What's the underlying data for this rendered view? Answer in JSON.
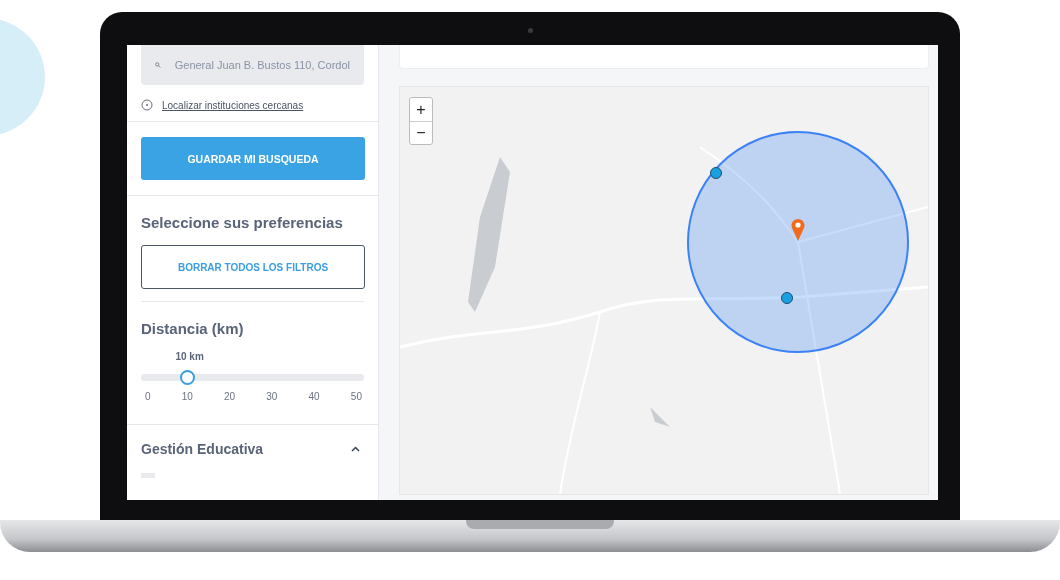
{
  "sidebar": {
    "search": {
      "value": "General Juan B. Bustos 110, Cordol"
    },
    "locate_link": "Localizar instituciones cercanas",
    "save_button": "GUARDAR MI BUSQUEDA",
    "preferences_title": "Seleccione sus preferencias",
    "clear_button": "BORRAR TODOS LOS FILTROS",
    "distance": {
      "title": "Distancia (km)",
      "reading": "10 km",
      "level": 0.2,
      "ticks": [
        "0",
        "10",
        "20",
        "30",
        "40",
        "50"
      ]
    },
    "sections": [
      {
        "title": "Gestión Educativa",
        "expanded": true
      }
    ]
  },
  "map": {
    "zoom_in": "+",
    "zoom_out": "−",
    "markers": [
      {
        "kind": "school"
      },
      {
        "kind": "school"
      },
      {
        "kind": "location"
      }
    ]
  }
}
